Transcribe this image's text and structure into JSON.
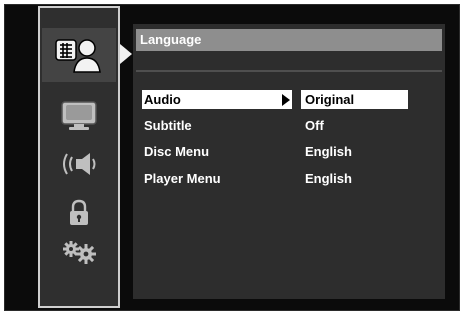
{
  "sidebar": {
    "items": [
      {
        "icon": "language-icon",
        "active": true
      },
      {
        "icon": "display-icon",
        "active": false
      },
      {
        "icon": "audio-icon",
        "active": false
      },
      {
        "icon": "lock-icon",
        "active": false
      },
      {
        "icon": "settings-icon",
        "active": false
      }
    ]
  },
  "panel": {
    "title": "Language",
    "rows": [
      {
        "label": "Audio",
        "value": "Original",
        "selected": true
      },
      {
        "label": "Subtitle",
        "value": "Off",
        "selected": false
      },
      {
        "label": "Disc Menu",
        "value": "English",
        "selected": false
      },
      {
        "label": "Player Menu",
        "value": "English",
        "selected": false
      }
    ]
  },
  "colors": {
    "background": "#0b0b0b",
    "panel": "#2d2d2d",
    "title_bar": "#8e8e8e",
    "highlight": "#ffffff"
  }
}
